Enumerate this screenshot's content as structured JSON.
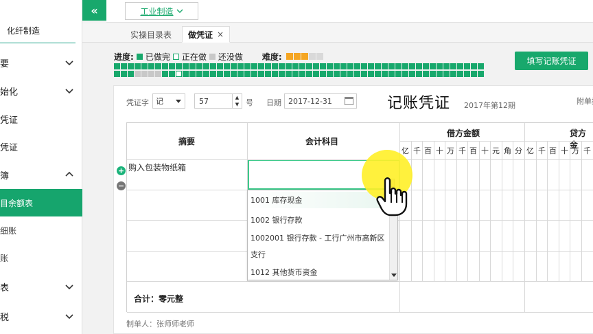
{
  "sidebar": {
    "brand": "化纤制造",
    "items": [
      {
        "label": "要",
        "chevron": "down"
      },
      {
        "label": "始化",
        "chevron": "down"
      },
      {
        "label": "凭证",
        "chevron": ""
      },
      {
        "label": "凭证",
        "chevron": ""
      },
      {
        "label": "簿",
        "chevron": "up"
      },
      {
        "label": "目余额表",
        "chevron": "",
        "active": true
      },
      {
        "label": "细账",
        "chevron": ""
      },
      {
        "label": "账",
        "chevron": ""
      },
      {
        "label": "表",
        "chevron": "down"
      },
      {
        "label": "税",
        "chevron": "down"
      }
    ]
  },
  "topbar": {
    "collapse_label": "«",
    "industry": "工业制造"
  },
  "tabs": [
    {
      "label": "实操目录表"
    },
    {
      "label": "做凭证",
      "close": "×"
    }
  ],
  "progress": {
    "label": "进度:",
    "done_label": "已做完",
    "doing_label": "正在做",
    "todo_label": "还没做",
    "difficulty_label": "难度:",
    "difficulty_value": 3,
    "difficulty_max": 5,
    "row1": "DDDDDDDDDDDDDDDDDDDDDDDDDDDDDDDDDDDDDDDDDDDDDDDDDDDDDD",
    "row2": "DDDTTTTDDDDDDDDDDDDDDDDDDDDDDDDDDDDDDDDDDDDDDDDDDDDDDD"
  },
  "fill_button": "填写记账凭证",
  "voucher": {
    "word_label": "凭证字",
    "word_value": "记",
    "number_value": "57",
    "number_suffix": "号",
    "date_label": "日期",
    "date_value": "2017-12-31",
    "title": "记账凭证",
    "period": "2017年第12期",
    "attach_label": "附单据"
  },
  "table": {
    "col_summary": "摘要",
    "col_account": "会计科目",
    "col_debit": "借方金额",
    "col_credit": "贷方金",
    "debit_digits": [
      "亿",
      "千",
      "百",
      "十",
      "万",
      "千",
      "百",
      "十",
      "元",
      "角",
      "分"
    ],
    "credit_digits": [
      "亿",
      "千",
      "百",
      "十",
      "万",
      "千"
    ],
    "row1_summary": "购入包装物纸箱",
    "total": "合计：零元整"
  },
  "dropdown": {
    "items": [
      "1001 库存现金",
      "1002 银行存款",
      "1002001 银行存款 - 工行广州市高新区",
      "支行",
      "1012 其他货币资金"
    ]
  },
  "maker": "制单人：张师师老师",
  "colors": {
    "accent": "#18a86c",
    "highlight": "#fff028"
  }
}
